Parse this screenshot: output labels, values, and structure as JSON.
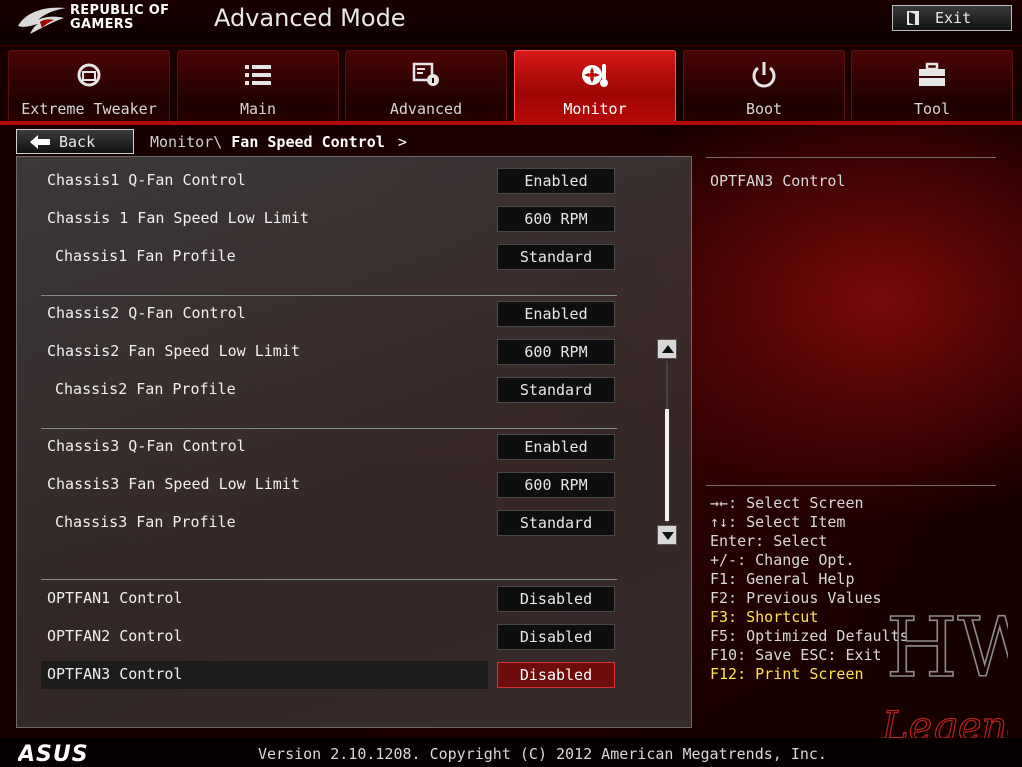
{
  "header": {
    "brand_line1": "REPUBLIC OF",
    "brand_line2": "GAMERS",
    "mode_title": "Advanced Mode",
    "exit_label": "Exit"
  },
  "tabs": [
    {
      "label": "Extreme Tweaker",
      "icon": "extreme-tweaker-icon",
      "active": false
    },
    {
      "label": "Main",
      "icon": "list-icon",
      "active": false
    },
    {
      "label": "Advanced",
      "icon": "advanced-settings-icon",
      "active": false
    },
    {
      "label": "Monitor",
      "icon": "thermometer-fan-icon",
      "active": true
    },
    {
      "label": "Boot",
      "icon": "power-icon",
      "active": false
    },
    {
      "label": "Tool",
      "icon": "toolbox-icon",
      "active": false
    }
  ],
  "nav": {
    "back_label": "Back",
    "breadcrumb_prefix": "Monitor\\",
    "breadcrumb_current": "Fan Speed Control",
    "breadcrumb_arrow": ">"
  },
  "settings": [
    {
      "label": "Chassis1 Q-Fan Control",
      "value": "Enabled"
    },
    {
      "label": "Chassis 1 Fan Speed Low Limit",
      "value": "600 RPM"
    },
    {
      "label": "Chassis1 Fan Profile",
      "value": "Standard"
    },
    {
      "label": "Chassis2 Q-Fan Control",
      "value": "Enabled"
    },
    {
      "label": "Chassis2 Fan Speed Low Limit",
      "value": "600 RPM"
    },
    {
      "label": "Chassis2 Fan Profile",
      "value": "Standard"
    },
    {
      "label": "Chassis3 Q-Fan Control",
      "value": "Enabled"
    },
    {
      "label": "Chassis3 Fan Speed Low Limit",
      "value": "600 RPM"
    },
    {
      "label": "Chassis3 Fan Profile",
      "value": "Standard"
    },
    {
      "label": "OPTFAN1 Control",
      "value": "Disabled"
    },
    {
      "label": "OPTFAN2 Control",
      "value": "Disabled"
    },
    {
      "label": "OPTFAN3 Control",
      "value": "Disabled"
    }
  ],
  "help": {
    "title": "OPTFAN3 Control",
    "keys": [
      "→←: Select Screen",
      "↑↓: Select Item",
      "Enter: Select",
      "+/-: Change Opt.",
      "F1: General Help",
      "F2: Previous Values",
      "F3: Shortcut",
      "F5: Optimized Defaults",
      "F10: Save  ESC: Exit",
      "F12: Print Screen"
    ]
  },
  "watermark": {
    "line1": "HW",
    "line2": "Legend"
  },
  "footer": {
    "logo_text": "ASUS",
    "version": "Version 2.10.1208. Copyright (C) 2012 American Megatrends, Inc."
  },
  "colors": {
    "accent_red": "#b40909",
    "active_tab": "#d71818",
    "highlight_key": "#ffe34a",
    "selected_value": "#6e0b0b"
  }
}
